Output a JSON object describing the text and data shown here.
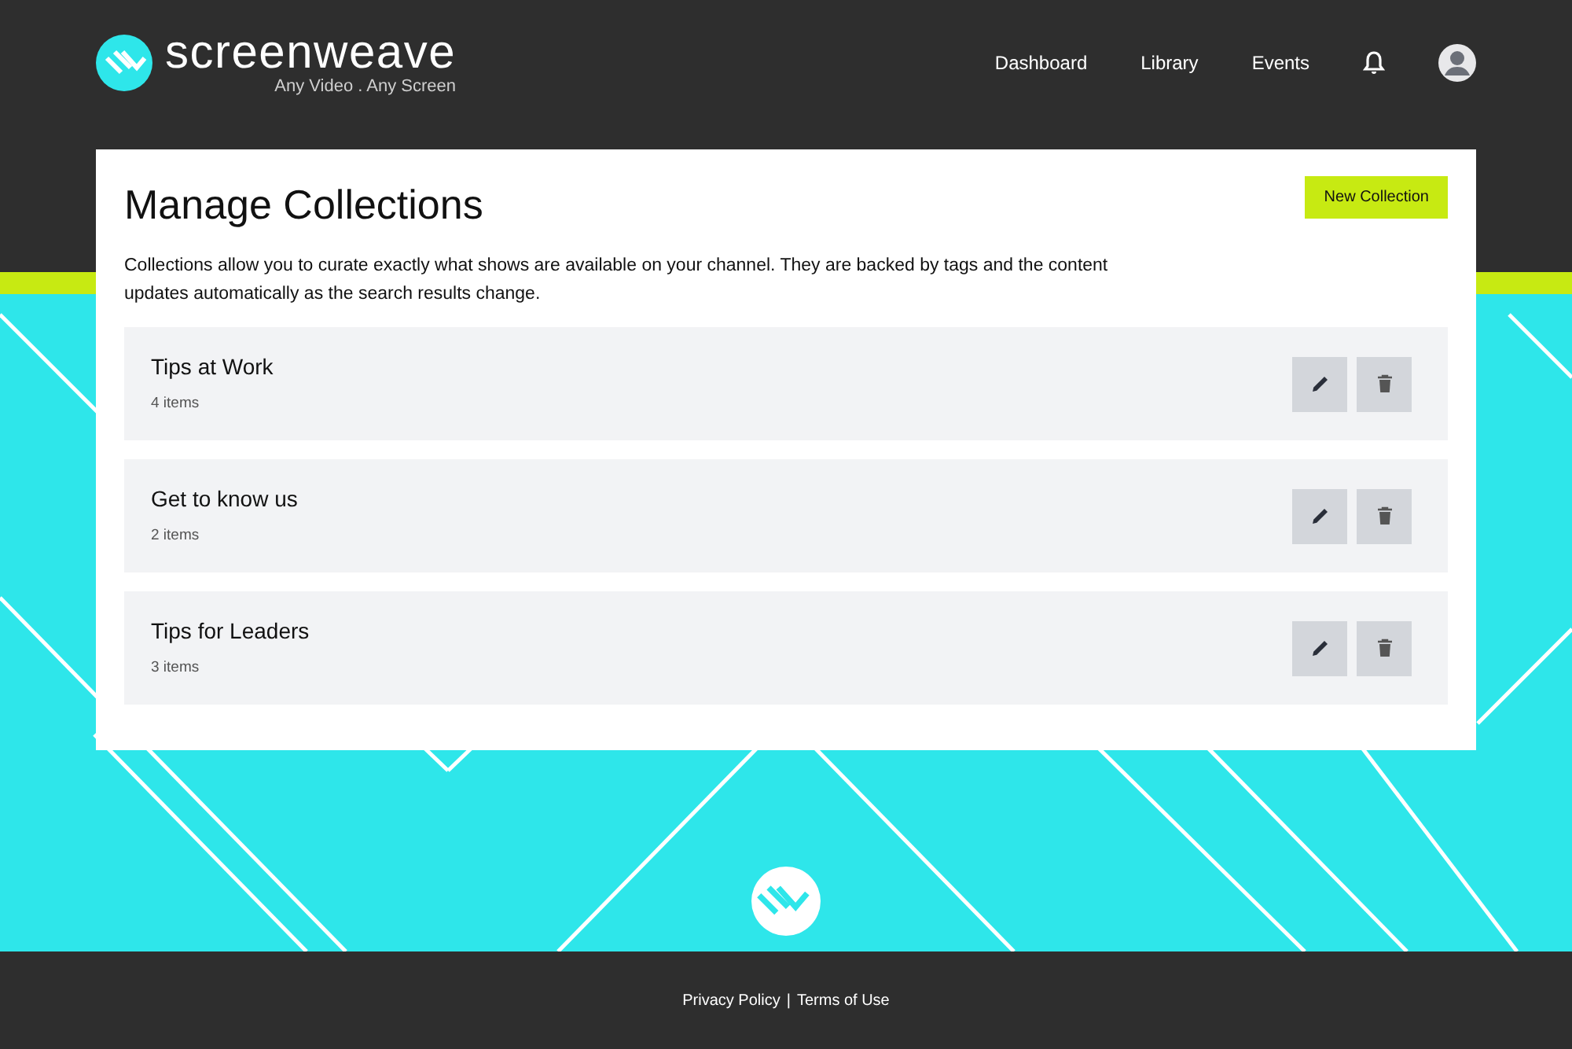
{
  "brand": {
    "name": "screenweave",
    "tagline": "Any Video . Any Screen"
  },
  "nav": [
    {
      "label": "Dashboard"
    },
    {
      "label": "Library"
    },
    {
      "label": "Events"
    }
  ],
  "page": {
    "title": "Manage Collections",
    "button": "New Collection",
    "description": "Collections allow you to curate exactly what shows are available on your channel. They are backed by tags and the content updates automatically as the search results change."
  },
  "collections": [
    {
      "name": "Tips at Work",
      "count": "4 items"
    },
    {
      "name": "Get to know us",
      "count": "2 items"
    },
    {
      "name": "Tips for Leaders",
      "count": "3 items"
    }
  ],
  "footer": {
    "links": [
      "Privacy Policy",
      "Terms of Use"
    ],
    "separator": "|"
  }
}
